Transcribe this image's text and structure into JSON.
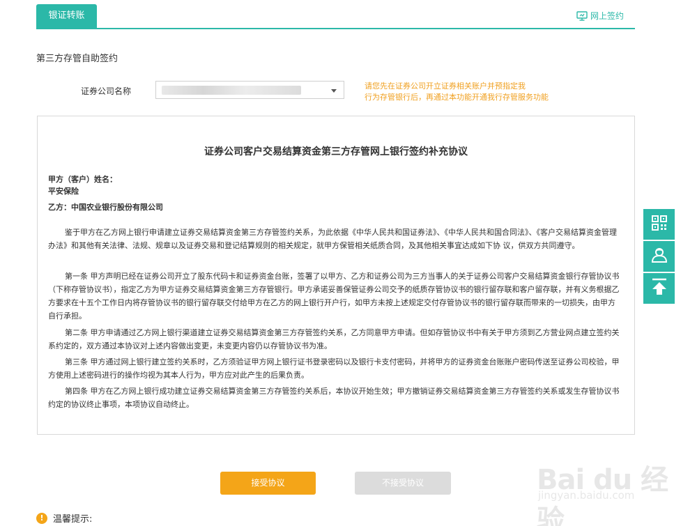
{
  "tabs": {
    "active": "银证转账",
    "online_sign": "网上签约"
  },
  "section_title": "第三方存管自助签约",
  "form": {
    "company_label": "证券公司名称",
    "notice_line1": "请您先在证券公司开立证券相关账户并预指定我",
    "notice_line2": "行为存管银行后，再通过本功能开通我行存管服务功能"
  },
  "agreement": {
    "title": "证券公司客户交易结算资金第三方存管网上银行签约补充协议",
    "party_a_label": "甲方（客户）姓名：",
    "party_a_name": "平安保险",
    "party_b": "乙方：中国农业银行股份有限公司",
    "paragraphs": [
      "鉴于甲方在乙方网上银行申请建立证券交易结算资金第三方存管签约关系，为此依据《中华人民共和国证券法》、《中华人民共和国合同法》、《客户交易结算资金管理办法》和其他有关法律、法规、规章以及证券交易和登记结算规则的相关规定，就甲方保管相关纸质合同，及其他相关事宜达成如下协 议，供双方共同遵守。",
      "第一条 甲方声明已经在证券公司开立了股东代码卡和证券资金台账，签署了以甲方、乙方和证券公司为三方当事人的关于证券公司客户交易结算资金银行存管协议书（下称存管协议书），指定乙方为甲方证券交易结算资金第三方存管银行。甲方承诺妥善保管证券公司交予的纸质存管协议书的银行留存联和客户留存联，并有义务根据乙方要求在十五个工作日内将存管协议书的银行留存联交付给甲方在乙方的网上银行开户行，如甲方未按上述规定交付存管协议书的银行留存联而带来的一切损失，由甲方自行承担。",
      "第二条 甲方申请通过乙方网上银行渠道建立证券交易结算资金第三方存管签约关系，乙方同意甲方申请。但如存管协议书中有关于甲方须到乙方营业网点建立签约关系约定的，双方通过本协议对上述内容做出变更，未变更内容仍以存管协议书为准。",
      "第三条 甲方通过网上银行建立签约关系时，乙方须验证甲方网上银行证书登录密码以及银行卡支付密码，并将甲方的证券资金台账账户密码传送至证券公司校验，甲方使用上述密码进行的操作均视为其本人行为，甲方应对此产生的后果负责。",
      "第四条 甲方在乙方网上银行成功建立证券交易结算资金第三方存管签约关系后，本协议开始生效；甲方撤销证券交易结算资金第三方存管签约关系或发生存管协议书约定的协议终止事项，本项协议自动终止。"
    ]
  },
  "buttons": {
    "accept": "接受协议",
    "decline": "不接受协议"
  },
  "tip": {
    "icon_text": "!",
    "label": "温馨提示:"
  },
  "watermark": {
    "brand": "Bai du 经验",
    "url": "jingyan.baidu.com"
  },
  "colors": {
    "teal": "#2bb8a8",
    "orange": "#f4a518",
    "notice": "#f0a020"
  }
}
